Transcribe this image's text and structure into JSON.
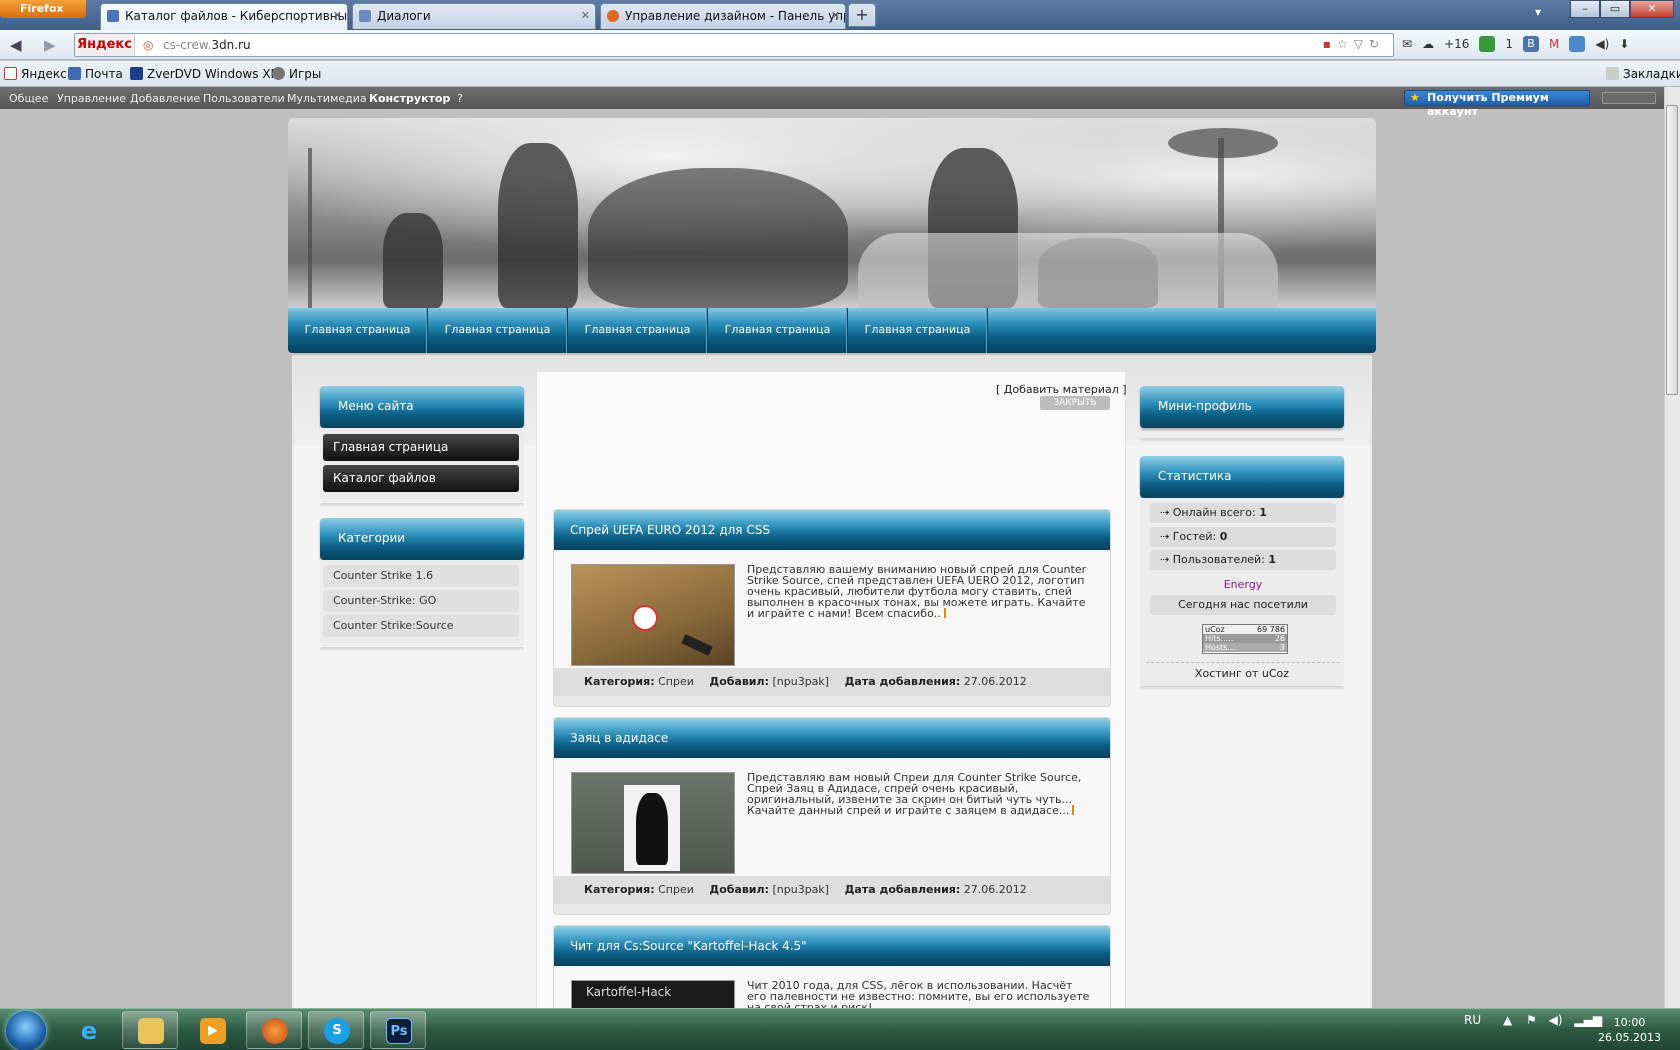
{
  "browser": {
    "app_button": "Firefox",
    "tabs": [
      {
        "title": "Каталог файлов - Киберспортивны...",
        "active": true
      },
      {
        "title": "Диалоги",
        "active": false
      },
      {
        "title": "Управление дизайном - Панель упр...",
        "active": false
      }
    ],
    "new_tab": "+",
    "url_prefix": "cs-crew.",
    "url_domain": "3dn.ru",
    "search_engine": "Яндекс",
    "notifications": "+16",
    "green_count": "1",
    "vk_label": "В",
    "bookmarks": [
      "Яндекс",
      "Почта",
      "ZverDVD Windows XP",
      "Игры"
    ],
    "bookmarks_menu": "Закладки"
  },
  "ucoz_bar": {
    "items": [
      "Общее",
      "Управление",
      "Добавление",
      "Пользователи",
      "Мультимедиа",
      "Конструктор",
      "?"
    ],
    "premium": "Получить Премиум аккаунт"
  },
  "site": {
    "top_menu": [
      "Главная страница",
      "Главная страница",
      "Главная страница",
      "Главная страница",
      "Главная страница"
    ],
    "left": {
      "menu_title": "Меню сайта",
      "menu_items": [
        "Главная страница",
        "Каталог файлов"
      ],
      "categories_title": "Категории",
      "categories": [
        "Counter Strike 1.6",
        "Counter-Strike: GO",
        "Counter Strike:Source"
      ]
    },
    "right": {
      "mini_profile_title": "Мини-профиль",
      "stats_title": "Статистика",
      "online_label": "Онлайн всего:",
      "online_value": "1",
      "guests_label": "Гостей:",
      "guests_value": "0",
      "users_label": "Пользователей:",
      "users_value": "1",
      "online_user": "Energy",
      "visited_today": "Сегодня нас посетили",
      "counter_brand": "uCoz",
      "counter_total": "69 786",
      "counter_hits_label": "Hits.....",
      "counter_hits": "26",
      "counter_hosts_label": "Hosts....",
      "counter_hosts": "3",
      "hosting": "Хостинг от uCoz"
    },
    "center": {
      "add_material": "[ Добавить материал ]",
      "close": "ЗАКРЫТЬ",
      "entries": [
        {
          "title": "Спрей UEFA EURO 2012 для CSS",
          "text": "Представляю вашему вниманию новый спрей для  Counter Strike Source, спей представлен UEFA UERO 2012, логотип очень красивый, любители футбола могу ставить, спей выполнен в красочных тонах, вы можете играть. Качайте и играйте с нами! Всем спасибо..",
          "category_label": "Категория:",
          "category": "Спреи",
          "author_label": "Добавил:",
          "author": "[npu3pak]",
          "date_label": "Дата добавления:",
          "date": "27.06.2012"
        },
        {
          "title": "Заяц в адидасе",
          "text": "Представляю вам новый Спреи для Counter Strike Source, Спрей Заяц в Адидасе, спрей очень красивый, оригинальный, извените за скрин он битый чуть чуть... Качайте данный спрей и играйте с заяцем в адидасе...",
          "category_label": "Категория:",
          "category": "Спреи",
          "author_label": "Добавил:",
          "author": "[npu3pak]",
          "date_label": "Дата добавления:",
          "date": "27.06.2012"
        },
        {
          "title": "Чит для Cs:Source \"Kartoffel-Hack 4.5\"",
          "text": "Чит 2010 года, для CSS, лёгок в использовании. Насчёт его палевности не известно: помните, вы его используете на свой страх и риск!",
          "thumb_caption": "Kartoffel-Hack"
        }
      ]
    }
  },
  "taskbar": {
    "language": "RU",
    "time": "10:00",
    "date": "26.05.2013",
    "apps": [
      "ie-icon",
      "explorer-icon",
      "media-player-icon",
      "firefox-icon",
      "skype-icon",
      "photoshop-icon"
    ]
  }
}
